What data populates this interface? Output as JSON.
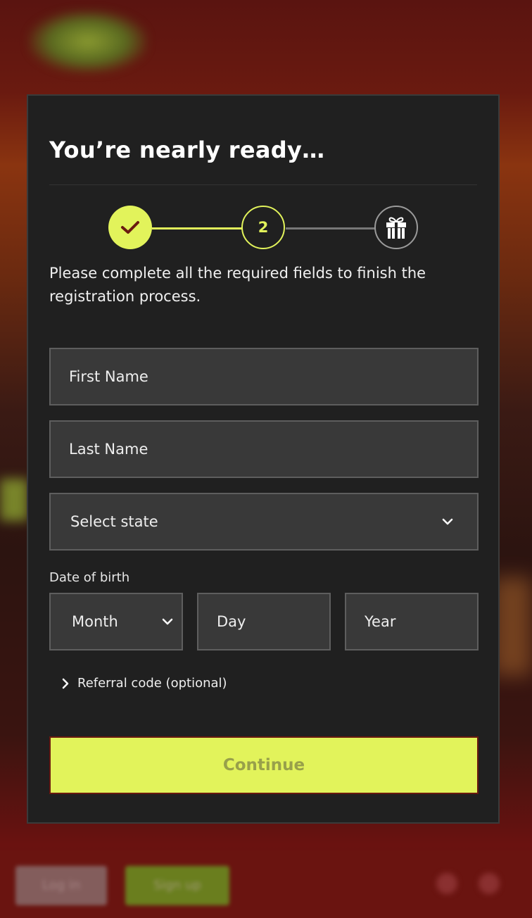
{
  "modal": {
    "title": "You’re nearly ready…",
    "description": "Please complete all the required fields to finish the registration process."
  },
  "stepper": {
    "current_step": "2",
    "steps": [
      {
        "state": "complete",
        "icon": "check-icon"
      },
      {
        "state": "current",
        "label": "2"
      },
      {
        "state": "upcoming",
        "icon": "gift-icon"
      }
    ]
  },
  "form": {
    "first_name_placeholder": "First Name",
    "last_name_placeholder": "Last Name",
    "state_select_value": "Select state",
    "dob_label": "Date of birth",
    "dob_month_value": "Month",
    "dob_day_placeholder": "Day",
    "dob_year_placeholder": "Year",
    "referral_label": "Referral code (optional)",
    "continue_label": "Continue"
  },
  "background": {
    "login_label": "Log in",
    "signup_label": "Sign up"
  },
  "colors": {
    "accent": "#e2f35b",
    "modal_bg": "#202020",
    "field_bg": "#393939"
  }
}
